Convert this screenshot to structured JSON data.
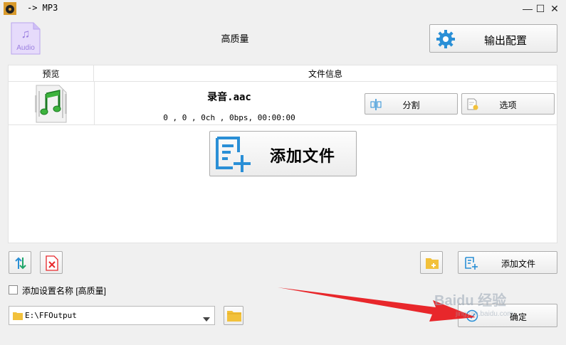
{
  "window": {
    "title": "-> MP3",
    "minimize": "—",
    "maximize": "☐",
    "close": "✕"
  },
  "header": {
    "format_badge": "Audio",
    "preset_label": "高质量",
    "output_config_label": "输出配置"
  },
  "file_list": {
    "columns": [
      "预览",
      "文件信息"
    ],
    "files": [
      {
        "name": "录音.aac",
        "meta": "0 , 0 , 0ch , 0bps, 00:00:00",
        "split_label": "分割",
        "options_label": "选项"
      }
    ],
    "add_file_big_label": "添加文件"
  },
  "toolbar": {
    "add_file_label": "添加文件"
  },
  "footer": {
    "save_name_label": "添加设置名称 [高质量]",
    "save_name_checked": false,
    "output_path": "E:\\FFOutput",
    "ok_label": "确定"
  },
  "colors": {
    "accent_blue": "#2a8fd6",
    "audio_purple": "#9b7fe0",
    "folder_yellow": "#f2c13b",
    "annotation_red": "#e8272b"
  },
  "watermark": {
    "text": "Baidu 经验",
    "sub": "jingyan.baidu.com"
  }
}
